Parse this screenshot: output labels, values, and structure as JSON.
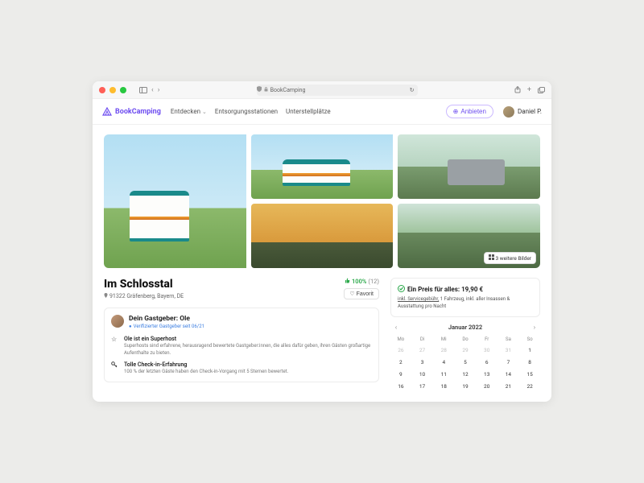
{
  "browser": {
    "page_title": "BookCamping"
  },
  "nav": {
    "brand": "BookCamping",
    "links": [
      "Entdecken",
      "Entsorgungsstationen",
      "Unterstellplätze"
    ],
    "offer_button": "Anbieten",
    "username": "Daniel P."
  },
  "gallery": {
    "more_label": "3 weitere Bilder"
  },
  "listing": {
    "title": "Im Schlosstal",
    "location": "91322 Gräfenberg, Bayern, DE",
    "approval_pct": "100%",
    "approval_count": "(12)",
    "favorite_label": "Favorit"
  },
  "host": {
    "heading": "Dein Gastgeber: Ole",
    "verified": "Verifizierter Gastgeber seit 06/21",
    "items": [
      {
        "title": "Ole ist ein Superhost",
        "sub": "Superhosts sind erfahrene, herausragend bewertete Gastgeber:innen, die alles dafür geben, ihren Gästen großartige Aufenthalte zu bieten."
      },
      {
        "title": "Tolle Check-in-Erfahrung",
        "sub": "100 % der letzten Gäste haben den Check-in-Vorgang mit 5 Sternen bewertet."
      }
    ]
  },
  "pricing": {
    "heading": "Ein Preis für alles: 19,90 €",
    "service_fee": "inkl. Servicegebühr,",
    "subline_rest": " 1 Fahrzeug, inkl. aller Insassen & Ausstattung pro Nacht"
  },
  "calendar": {
    "month_label": "Januar 2022",
    "dow": [
      "Mo",
      "Di",
      "Mi",
      "Do",
      "Fr",
      "Sa",
      "So"
    ],
    "rows": [
      [
        {
          "n": "26",
          "m": true
        },
        {
          "n": "27",
          "m": true
        },
        {
          "n": "28",
          "m": true
        },
        {
          "n": "29",
          "m": true
        },
        {
          "n": "30",
          "m": true
        },
        {
          "n": "31",
          "m": true
        },
        {
          "n": "1"
        }
      ],
      [
        {
          "n": "2"
        },
        {
          "n": "3"
        },
        {
          "n": "4"
        },
        {
          "n": "5"
        },
        {
          "n": "6"
        },
        {
          "n": "7"
        },
        {
          "n": "8"
        }
      ],
      [
        {
          "n": "9"
        },
        {
          "n": "10"
        },
        {
          "n": "11"
        },
        {
          "n": "12"
        },
        {
          "n": "13"
        },
        {
          "n": "14"
        },
        {
          "n": "15"
        }
      ],
      [
        {
          "n": "16"
        },
        {
          "n": "17"
        },
        {
          "n": "18"
        },
        {
          "n": "19"
        },
        {
          "n": "20"
        },
        {
          "n": "21"
        },
        {
          "n": "22"
        }
      ]
    ]
  }
}
